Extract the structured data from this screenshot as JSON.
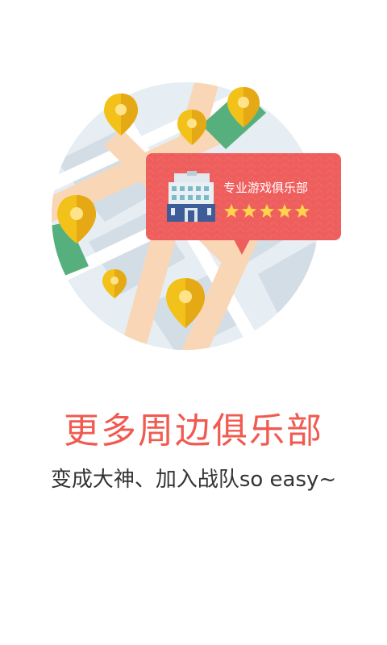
{
  "card": {
    "title": "专业游戏俱乐部",
    "rating": 5
  },
  "headline": "更多周边俱乐部",
  "subtitle": "变成大神、加入战队so easy~",
  "colors": {
    "accent": "#f05a50",
    "card_bg": "#ee5e5c",
    "pin": "#f2c21a",
    "star": "#ffd34d"
  }
}
